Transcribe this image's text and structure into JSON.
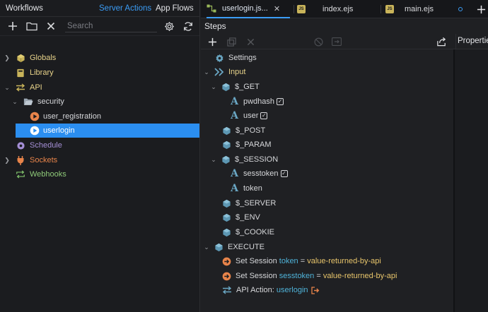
{
  "left": {
    "tabs": [
      "Workflows",
      "Server Actions",
      "App Flows"
    ],
    "active_tab": "Server Actions",
    "search_placeholder": "Search",
    "tree": [
      {
        "label": "Globals",
        "icon": "cube-icon"
      },
      {
        "label": "Library",
        "icon": "book-icon"
      },
      {
        "label": "API",
        "icon": "swap-arrows-icon"
      },
      {
        "label": "security",
        "icon": "folder-open-icon"
      },
      {
        "label": "user_registration",
        "icon": "play-circle-icon"
      },
      {
        "label": "userlogin",
        "icon": "play-circle-icon"
      },
      {
        "label": "Schedule",
        "icon": "gear-icon"
      },
      {
        "label": "Sockets",
        "icon": "plug-icon"
      },
      {
        "label": "Webhooks",
        "icon": "loop-arrows-icon"
      }
    ]
  },
  "editor": {
    "tabs": [
      {
        "name": "userlogin.js...",
        "icon": "flow-icon"
      },
      {
        "name": "index.ejs",
        "icon": "js-badge-icon"
      },
      {
        "name": "main.ejs",
        "icon": "js-badge-icon"
      }
    ],
    "steps_title": "Steps",
    "properties_title": "Properties",
    "steps": {
      "settings": "Settings",
      "input": "Input",
      "get": "$_GET",
      "pwdhash": "pwdhash",
      "user": "user",
      "post": "$_POST",
      "param": "$_PARAM",
      "session": "$_SESSION",
      "sesstoken": "sesstoken",
      "token": "token",
      "server": "$_SERVER",
      "env": "$_ENV",
      "cookie": "$_COOKIE",
      "execute": "EXECUTE",
      "set_session_1": {
        "prefix": "Set Session",
        "var": "token",
        "eq": "=",
        "value": "value-returned-by-api"
      },
      "set_session_2": {
        "prefix": "Set Session",
        "var": "sesstoken",
        "eq": "=",
        "value": "value-returned-by-api"
      },
      "api_action": {
        "prefix": "API Action:",
        "target": "userlogin"
      }
    }
  },
  "colors": {
    "accent": "#3b9cf5",
    "selection": "#2b8ef0",
    "yellow_label": "#e8d38a",
    "orange": "#e8844a",
    "teal": "#6aa7c4"
  }
}
